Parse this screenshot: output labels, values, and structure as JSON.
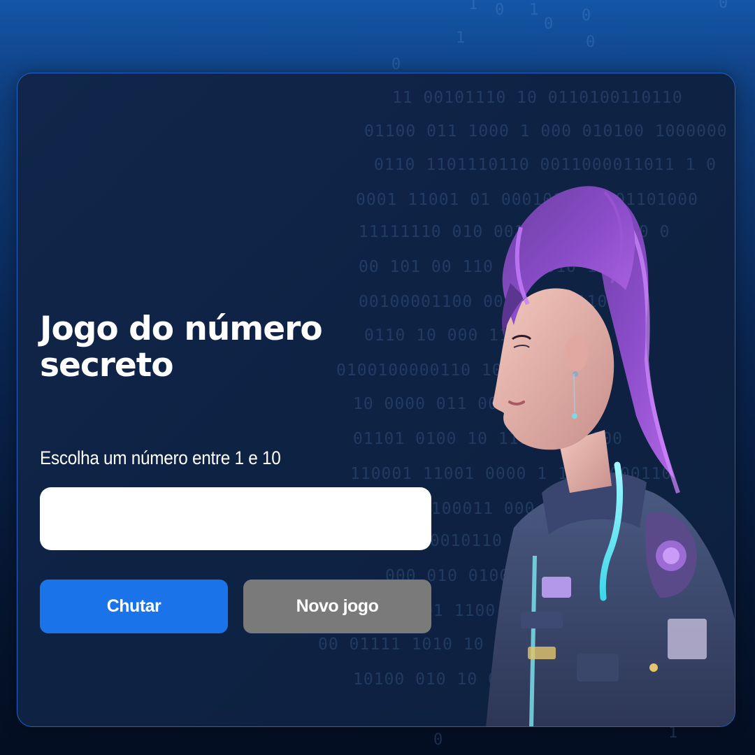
{
  "page": {
    "title": "Jogo do número secreto",
    "instruction": "Escolha um número entre 1 e 10"
  },
  "input": {
    "value": "",
    "type": "number"
  },
  "buttons": {
    "guess_label": "Chutar",
    "new_game_label": "Novo jogo"
  },
  "illustration": {
    "icon": "astronaut-girl-illustration"
  },
  "colors": {
    "primary_button": "#1a73e8",
    "secondary_button": "#7a7a7a",
    "card_border": "#1f63c7",
    "background_top": "#1456a8",
    "background_bottom": "#040e22"
  }
}
